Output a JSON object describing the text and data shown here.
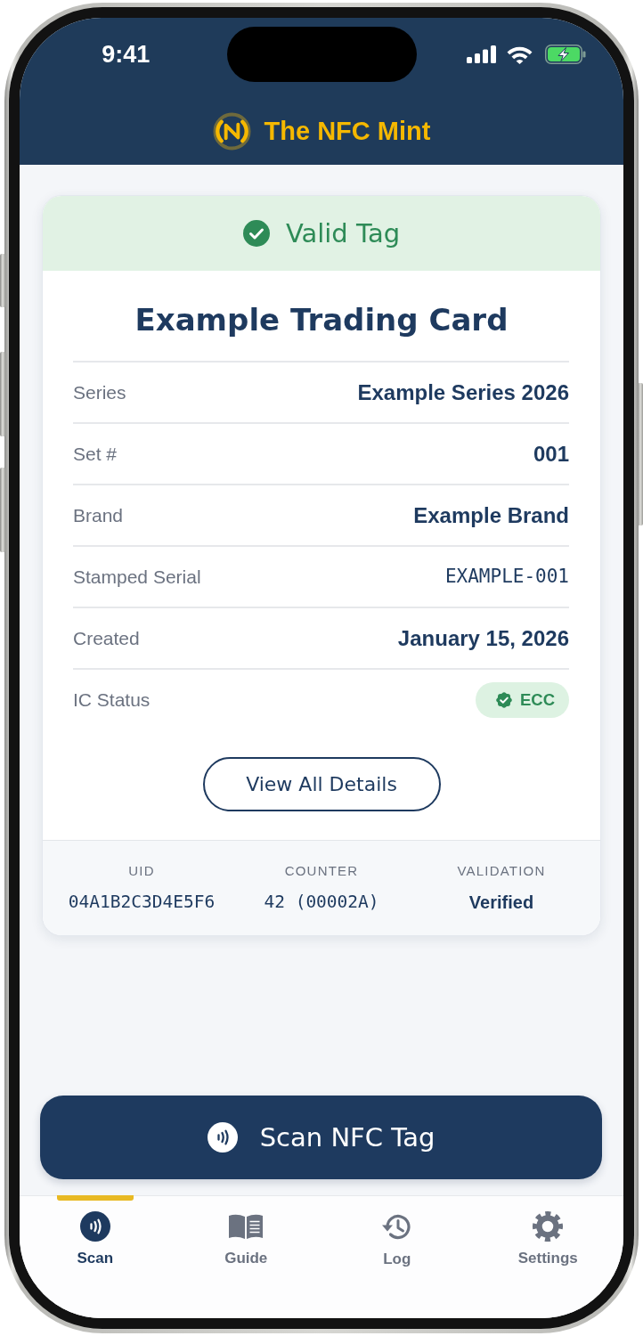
{
  "status_bar": {
    "time": "9:41"
  },
  "header": {
    "title": "The NFC Mint"
  },
  "result_card": {
    "status": {
      "label": "Valid Tag",
      "valid": true
    },
    "title": "Example Trading Card",
    "fields": [
      {
        "label": "Series",
        "value": "Example Series 2026",
        "kind": "text"
      },
      {
        "label": "Set #",
        "value": "001",
        "kind": "text"
      },
      {
        "label": "Brand",
        "value": "Example Brand",
        "kind": "text"
      },
      {
        "label": "Stamped Serial",
        "value": "EXAMPLE-001",
        "kind": "mono"
      },
      {
        "label": "Created",
        "value": "January 15, 2026",
        "kind": "text"
      },
      {
        "label": "IC Status",
        "value": "ECC",
        "kind": "badge"
      }
    ],
    "details_button": "View All Details",
    "summary": [
      {
        "label": "UID",
        "value": "04A1B2C3D4E5F6",
        "kind": "mono"
      },
      {
        "label": "COUNTER",
        "value": "42 (00002A)",
        "kind": "mono"
      },
      {
        "label": "VALIDATION",
        "value": "Verified",
        "kind": "text"
      }
    ]
  },
  "scan_button": {
    "label": "Scan NFC Tag"
  },
  "tab_bar": {
    "tabs": [
      {
        "label": "Scan",
        "selected": true
      },
      {
        "label": "Guide",
        "selected": false
      },
      {
        "label": "Log",
        "selected": false
      },
      {
        "label": "Settings",
        "selected": false
      }
    ]
  }
}
